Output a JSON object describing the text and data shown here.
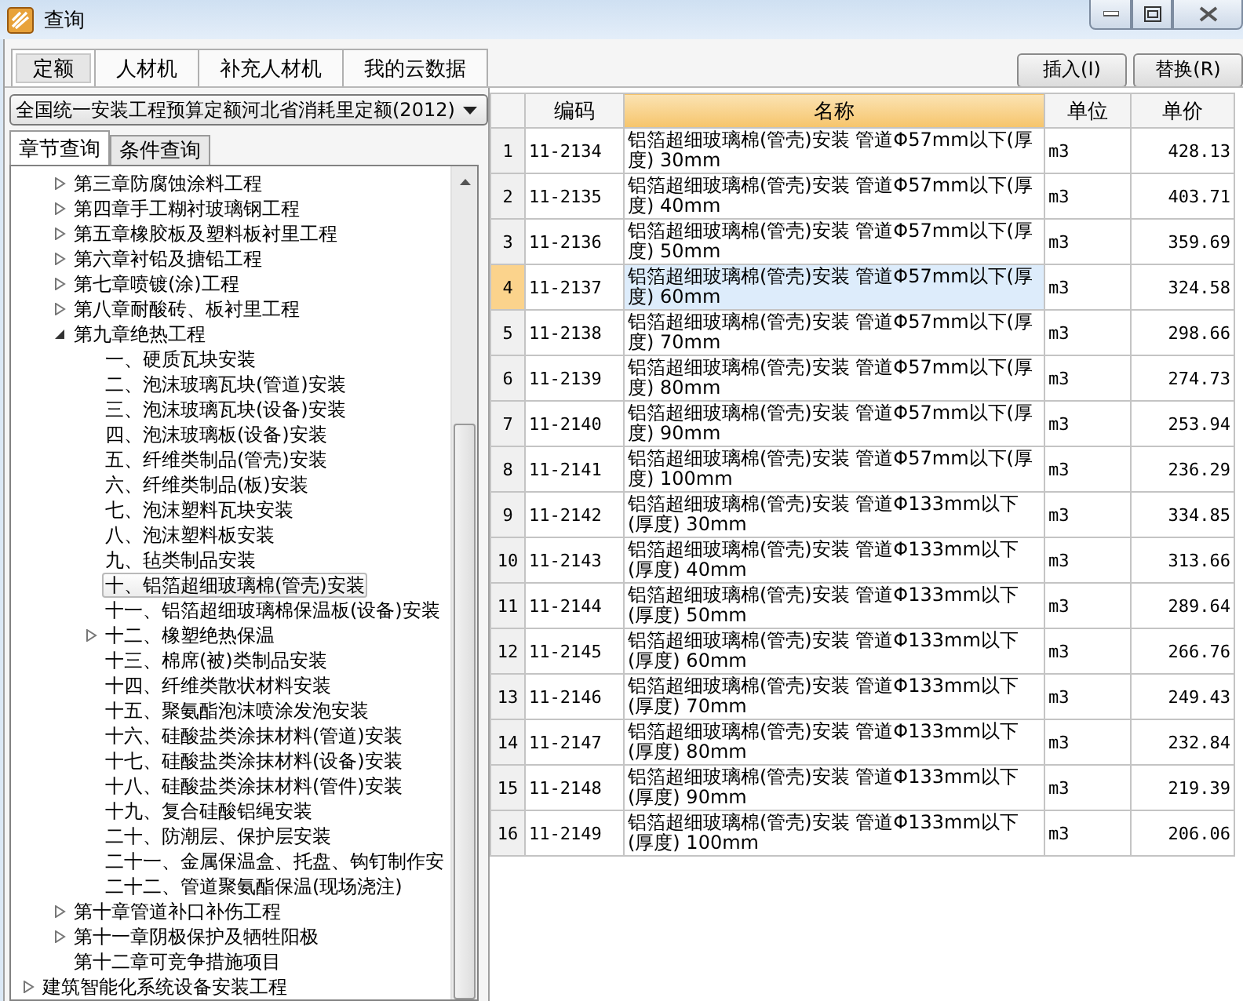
{
  "window": {
    "title": "查询"
  },
  "tabs": [
    {
      "label": "定额",
      "selected": true
    },
    {
      "label": "人材机",
      "selected": false
    },
    {
      "label": "补充人材机",
      "selected": false
    },
    {
      "label": "我的云数据",
      "selected": false
    }
  ],
  "buttons": [
    "插入(I)",
    "替换(R)"
  ],
  "quota_select": {
    "value": "全国统一安装工程预算定额河北省消耗里定额(2012)"
  },
  "sub_tabs": [
    {
      "label": "章节查询",
      "selected": true
    },
    {
      "label": "条件查询",
      "selected": false
    }
  ],
  "tree": [
    {
      "children": [
        {
          "label": "第三章防腐蚀涂料工程",
          "expanded": false,
          "selected": false
        },
        {
          "label": "第四章手工糊衬玻璃钢工程",
          "expanded": false,
          "selected": false
        },
        {
          "label": "第五章橡胶板及塑料板衬里工程",
          "expanded": false,
          "selected": false
        },
        {
          "label": "第六章衬铅及搪铅工程",
          "expanded": false,
          "selected": false
        },
        {
          "label": "第七章喷镀(涂)工程",
          "expanded": false,
          "selected": false
        },
        {
          "label": "第八章耐酸砖、板衬里工程",
          "expanded": false,
          "selected": false
        },
        {
          "label": "第九章绝热工程",
          "expanded": true,
          "selected": false,
          "children": [
            {
              "label": "一、硬质瓦块安装",
              "selected": false
            },
            {
              "label": "二、泡沫玻璃瓦块(管道)安装",
              "selected": false
            },
            {
              "label": "三、泡沫玻璃瓦块(设备)安装",
              "selected": false
            },
            {
              "label": "四、泡沫玻璃板(设备)安装",
              "selected": false
            },
            {
              "label": "五、纤维类制品(管壳)安装",
              "selected": false
            },
            {
              "label": "六、纤维类制品(板)安装",
              "selected": false
            },
            {
              "label": "七、泡沫塑料瓦块安装",
              "selected": false
            },
            {
              "label": "八、泡沫塑料板安装",
              "selected": false
            },
            {
              "label": "九、毡类制品安装",
              "selected": false
            },
            {
              "label": "十、铝箔超细玻璃棉(管壳)安装",
              "selected": true
            },
            {
              "label": "十一、铝箔超细玻璃棉保温板(设备)安装",
              "selected": false
            },
            {
              "label": "十二、橡塑绝热保温",
              "expanded": false,
              "selected": false
            },
            {
              "label": "十三、棉席(被)类制品安装",
              "selected": false
            },
            {
              "label": "十四、纤维类散状材料安装",
              "selected": false
            },
            {
              "label": "十五、聚氨酯泡沫喷涂发泡安装",
              "selected": false
            },
            {
              "label": "十六、硅酸盐类涂抹材料(管道)安装",
              "selected": false
            },
            {
              "label": "十七、硅酸盐类涂抹材料(设备)安装",
              "selected": false
            },
            {
              "label": "十八、硅酸盐类涂抹材料(管件)安装",
              "selected": false
            },
            {
              "label": "十九、复合硅酸铝绳安装",
              "selected": false
            },
            {
              "label": "二十、防潮层、保护层安装",
              "selected": false
            },
            {
              "label": "二十一、金属保温盒、托盘、钩钉制作安",
              "selected": false
            },
            {
              "label": "二十二、管道聚氨酯保温(现场浇注)",
              "selected": false
            }
          ]
        },
        {
          "label": "第十章管道补口补伤工程",
          "expanded": false,
          "selected": false
        },
        {
          "label": "第十一章阴极保护及牺牲阳极",
          "expanded": false,
          "selected": false
        },
        {
          "label": "第十二章可竞争措施项目",
          "selected": false
        }
      ]
    },
    {
      "label": "建筑智能化系统设备安装工程",
      "expanded": false,
      "selected": false
    }
  ],
  "table": {
    "columns": [
      {
        "label": "编码",
        "selected": false
      },
      {
        "label": "名称",
        "selected": true
      },
      {
        "label": "单位",
        "selected": false
      },
      {
        "label": "单价",
        "selected": false
      }
    ],
    "rows": [
      {
        "no": "1",
        "code": "11-2134",
        "name": "铝箔超细玻璃棉(管壳)安装 管道Φ57mm以下(厚度) 30mm",
        "unit": "m3",
        "price": "428.13",
        "selected": false
      },
      {
        "no": "2",
        "code": "11-2135",
        "name": "铝箔超细玻璃棉(管壳)安装 管道Φ57mm以下(厚度) 40mm",
        "unit": "m3",
        "price": "403.71",
        "selected": false
      },
      {
        "no": "3",
        "code": "11-2136",
        "name": "铝箔超细玻璃棉(管壳)安装 管道Φ57mm以下(厚度) 50mm",
        "unit": "m3",
        "price": "359.69",
        "selected": false
      },
      {
        "no": "4",
        "code": "11-2137",
        "name": "铝箔超细玻璃棉(管壳)安装 管道Φ57mm以下(厚度) 60mm",
        "unit": "m3",
        "price": "324.58",
        "selected": true
      },
      {
        "no": "5",
        "code": "11-2138",
        "name": "铝箔超细玻璃棉(管壳)安装 管道Φ57mm以下(厚度) 70mm",
        "unit": "m3",
        "price": "298.66",
        "selected": false
      },
      {
        "no": "6",
        "code": "11-2139",
        "name": "铝箔超细玻璃棉(管壳)安装 管道Φ57mm以下(厚度) 80mm",
        "unit": "m3",
        "price": "274.73",
        "selected": false
      },
      {
        "no": "7",
        "code": "11-2140",
        "name": "铝箔超细玻璃棉(管壳)安装 管道Φ57mm以下(厚度) 90mm",
        "unit": "m3",
        "price": "253.94",
        "selected": false
      },
      {
        "no": "8",
        "code": "11-2141",
        "name": "铝箔超细玻璃棉(管壳)安装 管道Φ57mm以下(厚度) 100mm",
        "unit": "m3",
        "price": "236.29",
        "selected": false
      },
      {
        "no": "9",
        "code": "11-2142",
        "name": "铝箔超细玻璃棉(管壳)安装 管道Φ133mm以下(厚度) 30mm",
        "unit": "m3",
        "price": "334.85",
        "selected": false
      },
      {
        "no": "10",
        "code": "11-2143",
        "name": "铝箔超细玻璃棉(管壳)安装 管道Φ133mm以下(厚度) 40mm",
        "unit": "m3",
        "price": "313.66",
        "selected": false
      },
      {
        "no": "11",
        "code": "11-2144",
        "name": "铝箔超细玻璃棉(管壳)安装 管道Φ133mm以下(厚度) 50mm",
        "unit": "m3",
        "price": "289.64",
        "selected": false
      },
      {
        "no": "12",
        "code": "11-2145",
        "name": "铝箔超细玻璃棉(管壳)安装 管道Φ133mm以下(厚度) 60mm",
        "unit": "m3",
        "price": "266.76",
        "selected": false
      },
      {
        "no": "13",
        "code": "11-2146",
        "name": "铝箔超细玻璃棉(管壳)安装 管道Φ133mm以下(厚度) 70mm",
        "unit": "m3",
        "price": "249.43",
        "selected": false
      },
      {
        "no": "14",
        "code": "11-2147",
        "name": "铝箔超细玻璃棉(管壳)安装 管道Φ133mm以下(厚度) 80mm",
        "unit": "m3",
        "price": "232.84",
        "selected": false
      },
      {
        "no": "15",
        "code": "11-2148",
        "name": "铝箔超细玻璃棉(管壳)安装 管道Φ133mm以下(厚度) 90mm",
        "unit": "m3",
        "price": "219.39",
        "selected": false
      },
      {
        "no": "16",
        "code": "11-2149",
        "name": "铝箔超细玻璃棉(管壳)安装 管道Φ133mm以下(厚度) 100mm",
        "unit": "m3",
        "price": "206.06",
        "selected": false
      }
    ]
  }
}
